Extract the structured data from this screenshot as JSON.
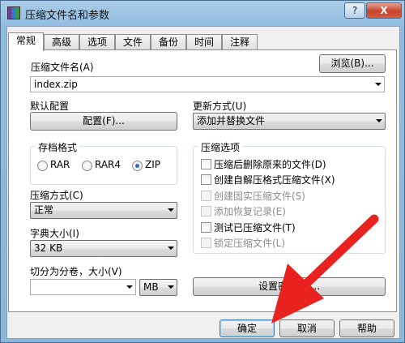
{
  "window": {
    "title": "压缩文件名和参数",
    "help_btn": "?",
    "close_btn": "X"
  },
  "tabs": [
    "常规",
    "高级",
    "选项",
    "文件",
    "备份",
    "时间",
    "注释"
  ],
  "archive_name": {
    "label": "压缩文件名(A)",
    "value": "index.zip",
    "browse_button": "浏览(B)..."
  },
  "profiles": {
    "label": "默认配置",
    "button": "配置(F)..."
  },
  "update_mode": {
    "label": "更新方式(U)",
    "value": "添加并替换文件"
  },
  "archive_format": {
    "title": "存档格式",
    "options": [
      "RAR",
      "RAR4",
      "ZIP"
    ],
    "selected": "ZIP"
  },
  "compression_method": {
    "label": "压缩方式(C)",
    "value": "正常"
  },
  "dictionary_size": {
    "label": "字典大小(I)",
    "value": "32 KB"
  },
  "split_volumes": {
    "label": "切分为分卷，大小(V)",
    "value": "",
    "unit": "MB"
  },
  "archive_options": {
    "title": "压缩选项",
    "items": [
      {
        "label": "压缩后删除原来的文件(D)",
        "checked": false,
        "disabled": false
      },
      {
        "label": "创建自解压格式压缩文件(X)",
        "checked": false,
        "disabled": false
      },
      {
        "label": "创建固实压缩文件(S)",
        "checked": false,
        "disabled": true
      },
      {
        "label": "添加恢复记录(E)",
        "checked": false,
        "disabled": true
      },
      {
        "label": "测试已压缩文件(T)",
        "checked": false,
        "disabled": false
      },
      {
        "label": "锁定压缩文件(L)",
        "checked": false,
        "disabled": true
      }
    ]
  },
  "set_password_button": "设置密码(P)...",
  "footer": {
    "ok": "确定",
    "cancel": "取消",
    "help": "帮助"
  },
  "colors": {
    "arrow": "#e8231f",
    "accent": "#3c7fb1"
  }
}
